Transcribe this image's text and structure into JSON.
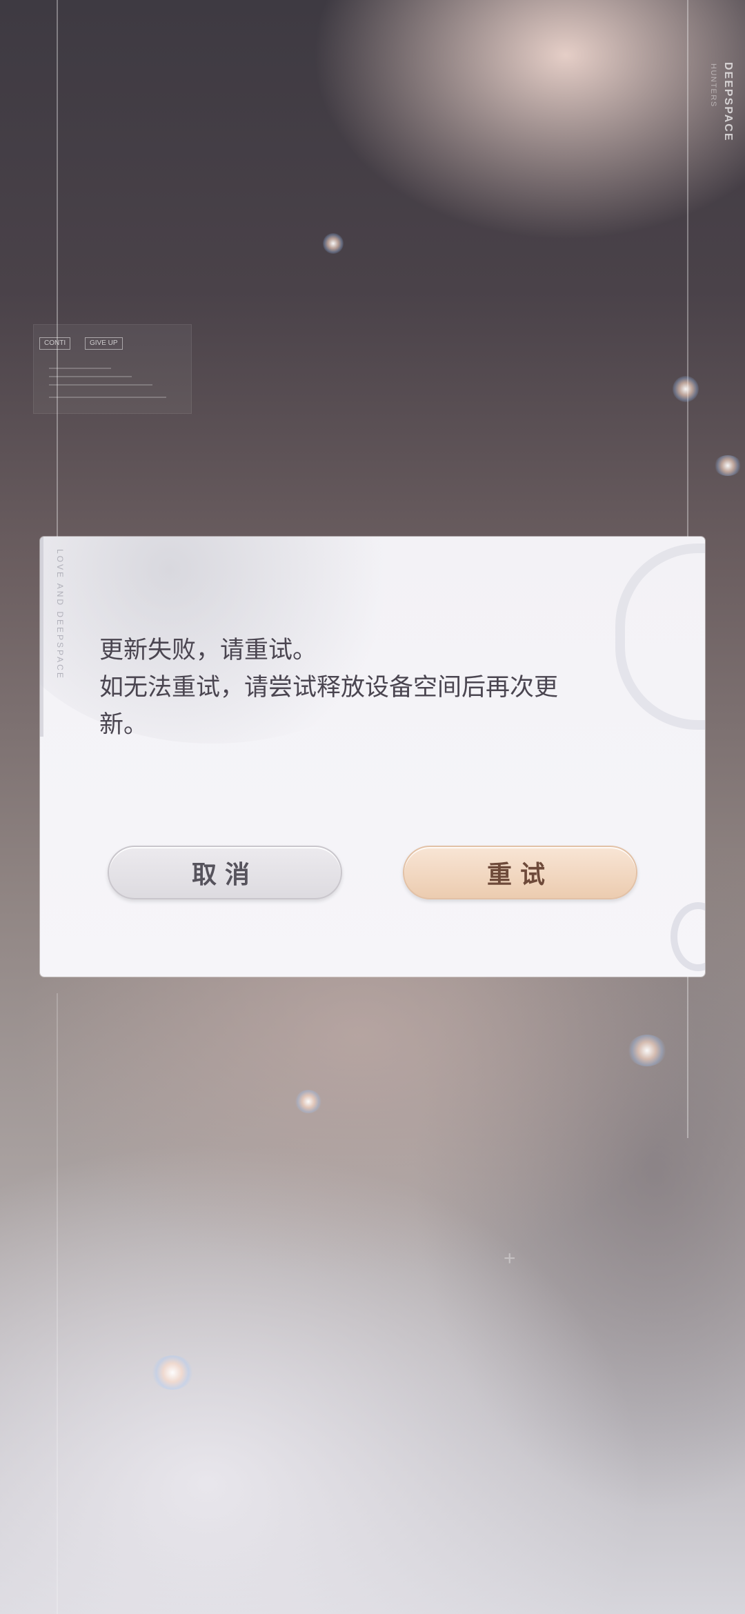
{
  "background": {
    "brand_title": "DEEPSPACE",
    "brand_subtitle": "HUNTERS",
    "hud_buttons": [
      "CONTI",
      "GIVE UP"
    ],
    "faint_bottom_text": "",
    "side_label": "LOVE AND DEEPSPACE"
  },
  "dialog": {
    "message": "更新失败，请重试。\n如无法重试，请尝试释放设备空间后再次更\n新。",
    "cancel_label": "取消",
    "retry_label": "重试"
  },
  "colors": {
    "dialog_bg": "#f5f4f8",
    "cancel_button": "#e4e2e6",
    "retry_button": "#f1d6c0",
    "message_text": "#4a4550"
  }
}
